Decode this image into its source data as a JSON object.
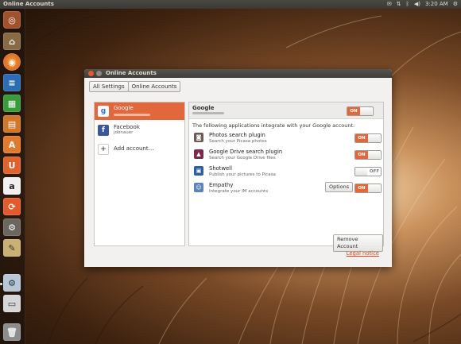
{
  "top_panel": {
    "title": "Online Accounts",
    "clock": "3:20 AM",
    "tray_icons": [
      "mail-icon",
      "network-icon",
      "bluetooth-icon",
      "volume-icon",
      "clock",
      "settings-gear-icon"
    ]
  },
  "launcher": {
    "items": [
      "ubuntu-dash-icon",
      "home-folder-icon",
      "firefox-icon",
      "writer-icon",
      "calc-icon",
      "impress-icon",
      "software-center-icon",
      "ubuntu-one-icon",
      "amazon-icon",
      "update-manager-icon",
      "system-settings-icon",
      "text-editor-icon",
      "online-accounts-icon",
      "file-manager-icon",
      "trash-icon"
    ]
  },
  "window": {
    "title": "Online Accounts",
    "breadcrumbs": [
      "All Settings",
      "Online Accounts"
    ],
    "accounts": [
      {
        "name": "Google",
        "icon": "google-icon",
        "selected": true
      },
      {
        "name": "Facebook",
        "sub": "jdonauer",
        "icon": "facebook-icon",
        "selected": false
      },
      {
        "name": "Add account…",
        "icon": "add-icon",
        "selected": false
      }
    ],
    "detail": {
      "title": "Google",
      "account_toggle": "ON",
      "intro": "The following applications integrate with your Google account:",
      "apps": [
        {
          "name": "Photos search plugin",
          "desc": "Search your Picasa photos",
          "state": "ON",
          "icon": "camera-icon",
          "icon_color": "#6e5b55"
        },
        {
          "name": "Google Drive search plugin",
          "desc": "Search your Google Drive files",
          "state": "ON",
          "icon": "drive-icon",
          "icon_color": "#7b2a4e"
        },
        {
          "name": "Shotwell",
          "desc": "Publish your pictures to Picasa",
          "state": "OFF",
          "icon": "shotwell-icon",
          "icon_color": "#2e5fa3"
        },
        {
          "name": "Empathy",
          "desc": "Integrate your IM accounts",
          "state": "ON",
          "icon": "empathy-icon",
          "icon_color": "#5b84b8",
          "options_label": "Options"
        }
      ],
      "remove_label": "Remove Account"
    },
    "legal_label": "Legal notice"
  },
  "colors": {
    "accent": "#e2673b",
    "link": "#d44a1e"
  }
}
